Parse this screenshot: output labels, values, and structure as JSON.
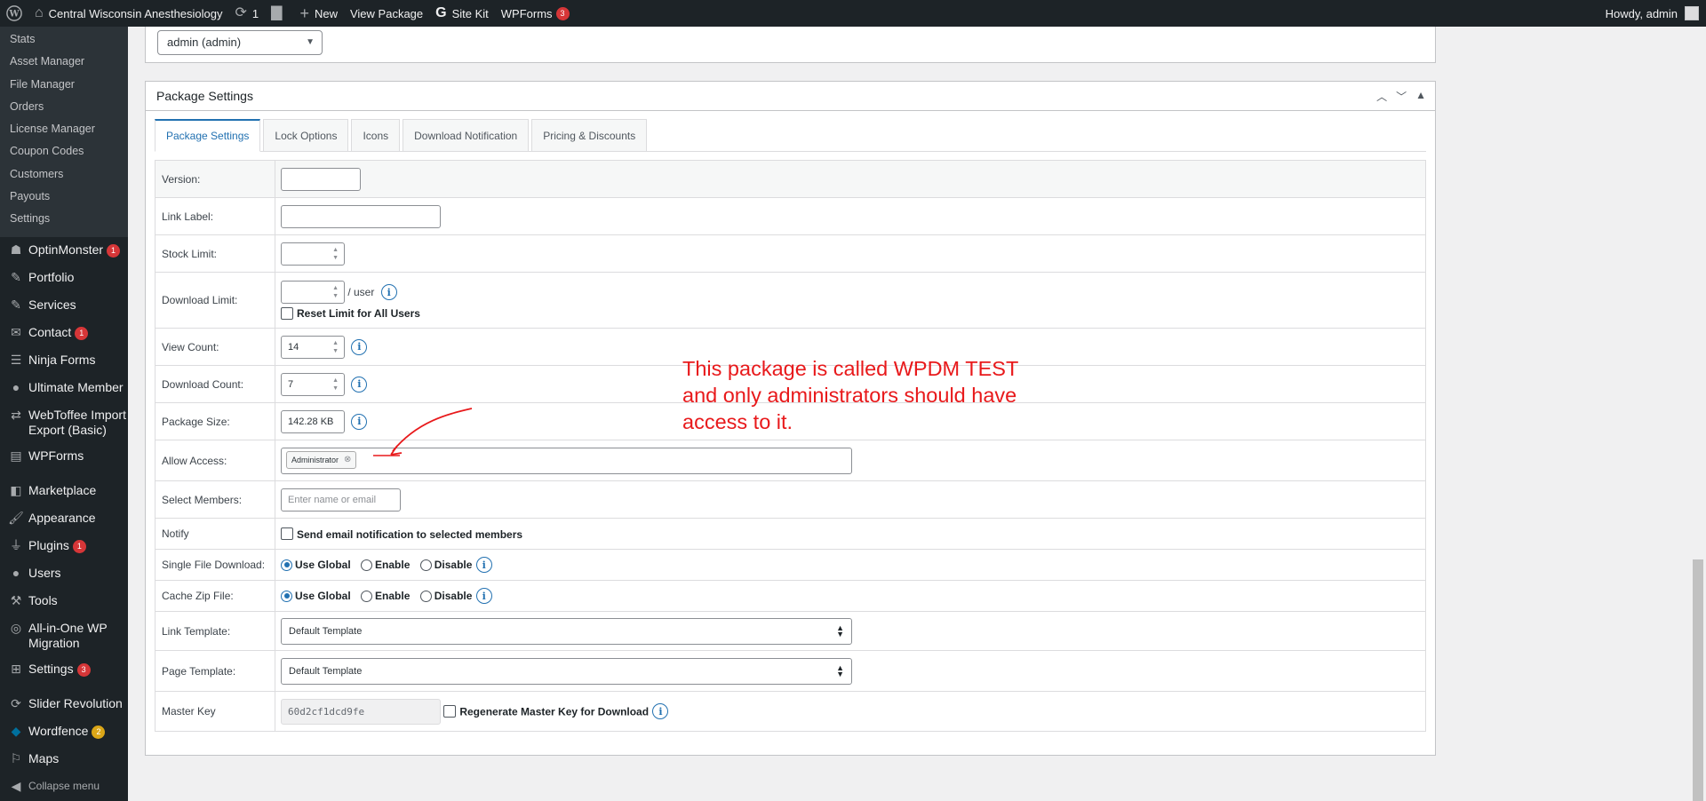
{
  "adminbar": {
    "site_name": "Central Wisconsin Anesthesiology",
    "updates_count": "1",
    "new_label": "New",
    "view_label": "View Package",
    "sitekit_label": "Site Kit",
    "wpforms_label": "WPForms",
    "wpforms_count": "3",
    "howdy": "Howdy, admin"
  },
  "sidebar": {
    "submenu": [
      "Stats",
      "Asset Manager",
      "File Manager",
      "Orders",
      "License Manager",
      "Coupon Codes",
      "Customers",
      "Payouts",
      "Settings"
    ],
    "menu": [
      {
        "label": "OptinMonster",
        "icon": "optinmonster-icon",
        "count": "1"
      },
      {
        "label": "Portfolio",
        "icon": "pin-icon"
      },
      {
        "label": "Services",
        "icon": "pin-icon"
      },
      {
        "label": "Contact",
        "icon": "mail-icon",
        "count": "1"
      },
      {
        "label": "Ninja Forms",
        "icon": "forms-icon"
      },
      {
        "label": "Ultimate Member",
        "icon": "user-icon"
      },
      {
        "label": "WebToffee Import Export (Basic)",
        "icon": "import-export-icon"
      },
      {
        "label": "WPForms",
        "icon": "wpforms-icon"
      },
      {
        "label": "Marketplace",
        "icon": "marketplace-icon"
      },
      {
        "label": "Appearance",
        "icon": "brush-icon"
      },
      {
        "label": "Plugins",
        "icon": "plugin-icon",
        "count": "1"
      },
      {
        "label": "Users",
        "icon": "users-icon"
      },
      {
        "label": "Tools",
        "icon": "wrench-icon"
      },
      {
        "label": "All-in-One WP Migration",
        "icon": "migration-icon"
      },
      {
        "label": "Settings",
        "icon": "settings-icon",
        "count": "3"
      },
      {
        "label": "Slider Revolution",
        "icon": "slider-icon"
      },
      {
        "label": "Wordfence",
        "icon": "wordfence-icon",
        "count": "2"
      },
      {
        "label": "Maps",
        "icon": "maps-icon"
      },
      {
        "label": "Collapse menu",
        "icon": "collapse-icon"
      }
    ]
  },
  "author": {
    "value": "admin (admin)"
  },
  "postbox": {
    "title": "Package Settings",
    "tabs": [
      "Package Settings",
      "Lock Options",
      "Icons",
      "Download Notification",
      "Pricing & Discounts"
    ]
  },
  "fields": {
    "version_label": "Version:",
    "link_label_label": "Link Label:",
    "stock_limit_label": "Stock Limit:",
    "download_limit_label": "Download Limit:",
    "per_user": "/ user",
    "reset_limit": "Reset Limit for All Users",
    "view_count_label": "View Count:",
    "view_count_value": "14",
    "download_count_label": "Download Count:",
    "download_count_value": "7",
    "package_size_label": "Package Size:",
    "package_size_value": "142.28 KB",
    "allow_access_label": "Allow Access:",
    "allow_access_tag": "Administrator",
    "select_members_label": "Select Members:",
    "select_members_placeholder": "Enter name or email",
    "notify_label": "Notify",
    "notify_text": "Send email notification to selected members",
    "single_file_label": "Single File Download:",
    "cache_zip_label": "Cache Zip File:",
    "opt_use_global": "Use Global",
    "opt_enable": "Enable",
    "opt_disable": "Disable",
    "link_template_label": "Link Template:",
    "link_template_value": "Default Template",
    "page_template_label": "Page Template:",
    "page_template_value": "Default Template",
    "master_key_label": "Master Key",
    "master_key_value": "60d2cf1dcd9fe",
    "regenerate_key": "Regenerate Master Key for Download"
  },
  "annotation": {
    "line1": "This package is called WPDM TEST",
    "line2": "and only administrators should have",
    "line3": "access to it.",
    "color": "#e8191b"
  },
  "colors": {
    "accent": "#2271b1",
    "adminbar": "#1d2327",
    "badge": "#d63638"
  }
}
